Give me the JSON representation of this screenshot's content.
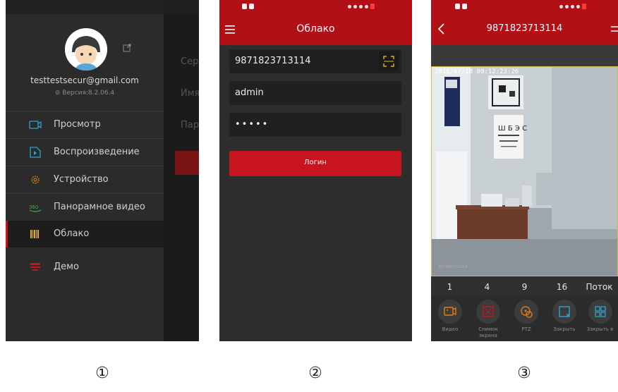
{
  "screen1": {
    "email": "testtestsecur@gmail.com",
    "version": "Версия:8.2.06.4",
    "bg_fields": [
      "Сер",
      "Имя",
      "Пар"
    ],
    "menu": [
      {
        "label": "Просмотр",
        "icon": "camera-icon",
        "color": "#2fa3c9"
      },
      {
        "label": "Воспроизведение",
        "icon": "playback-icon",
        "color": "#2fa3c9"
      },
      {
        "label": "Устройство",
        "icon": "gear-icon",
        "color": "#d77b1b"
      },
      {
        "label": "Панорамное видео",
        "icon": "panorama-360-icon",
        "color": "#2fbb3a"
      },
      {
        "label": "Облако",
        "icon": "cloud-icon",
        "color": "#e0b11c",
        "active": true
      },
      {
        "label": "Демо",
        "icon": "demo-icon",
        "color": "#c8141e"
      }
    ]
  },
  "screen2": {
    "title": "Облако",
    "serial": "9871823713114",
    "username": "admin",
    "password": "•••••",
    "login": "Логин"
  },
  "screen3": {
    "title": "9871823713114",
    "osd_time": "2018/07/18 09:12:23:26",
    "osd_id": "9871823713114",
    "tabs": [
      "1",
      "4",
      "9",
      "16",
      "Поток"
    ],
    "tools": [
      {
        "label": "Видео",
        "icon": "video-record-icon",
        "color": "#e07a1a"
      },
      {
        "label": "Снимок экрана",
        "icon": "screenshot-icon",
        "color": "#c8141e"
      },
      {
        "label": "PTZ",
        "icon": "ptz-icon",
        "color": "#e07a1a"
      },
      {
        "label": "Закрыть",
        "icon": "close-window-icon",
        "color": "#2fa3c9"
      },
      {
        "label": "Закрыть в",
        "icon": "close-all-icon",
        "color": "#2fa3c9"
      }
    ]
  },
  "captions": [
    "①",
    "②",
    "③"
  ],
  "colors": {
    "brand_red": "#b20f17",
    "button_red": "#c8141e"
  }
}
